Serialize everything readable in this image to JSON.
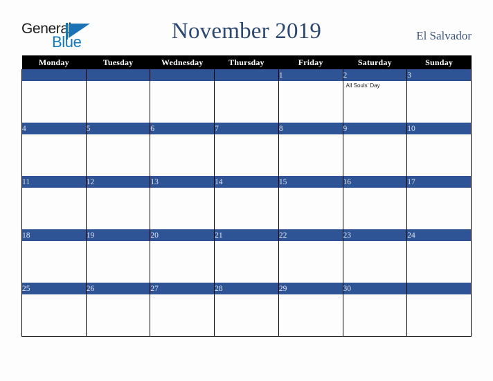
{
  "brand": {
    "word_general": "General",
    "word_blue": "Blue",
    "mark_icon": "triangle-flag-icon"
  },
  "header": {
    "title": "November 2019",
    "country": "El Salvador"
  },
  "calendar": {
    "weekday_headers": [
      "Monday",
      "Tuesday",
      "Wednesday",
      "Thursday",
      "Friday",
      "Saturday",
      "Sunday"
    ],
    "weeks": [
      {
        "days": [
          {
            "date": "",
            "event": ""
          },
          {
            "date": "",
            "event": ""
          },
          {
            "date": "",
            "event": ""
          },
          {
            "date": "",
            "event": ""
          },
          {
            "date": "1",
            "event": ""
          },
          {
            "date": "2",
            "event": "All Souls' Day"
          },
          {
            "date": "3",
            "event": ""
          }
        ]
      },
      {
        "days": [
          {
            "date": "4",
            "event": ""
          },
          {
            "date": "5",
            "event": ""
          },
          {
            "date": "6",
            "event": ""
          },
          {
            "date": "7",
            "event": ""
          },
          {
            "date": "8",
            "event": ""
          },
          {
            "date": "9",
            "event": ""
          },
          {
            "date": "10",
            "event": ""
          }
        ]
      },
      {
        "days": [
          {
            "date": "11",
            "event": ""
          },
          {
            "date": "12",
            "event": ""
          },
          {
            "date": "13",
            "event": ""
          },
          {
            "date": "14",
            "event": ""
          },
          {
            "date": "15",
            "event": ""
          },
          {
            "date": "16",
            "event": ""
          },
          {
            "date": "17",
            "event": ""
          }
        ]
      },
      {
        "days": [
          {
            "date": "18",
            "event": ""
          },
          {
            "date": "19",
            "event": ""
          },
          {
            "date": "20",
            "event": ""
          },
          {
            "date": "21",
            "event": ""
          },
          {
            "date": "22",
            "event": ""
          },
          {
            "date": "23",
            "event": ""
          },
          {
            "date": "24",
            "event": ""
          }
        ]
      },
      {
        "days": [
          {
            "date": "25",
            "event": ""
          },
          {
            "date": "26",
            "event": ""
          },
          {
            "date": "27",
            "event": ""
          },
          {
            "date": "28",
            "event": ""
          },
          {
            "date": "29",
            "event": ""
          },
          {
            "date": "30",
            "event": ""
          },
          {
            "date": "",
            "event": ""
          }
        ]
      }
    ]
  },
  "colors": {
    "page_background": "#fdfdfd",
    "header_row_background": "#000000",
    "date_bar_background": "#2e5496",
    "title_text": "#2c4770",
    "country_text": "#3a5580",
    "brand_blue": "#1279bd",
    "grid_line": "#000000"
  }
}
